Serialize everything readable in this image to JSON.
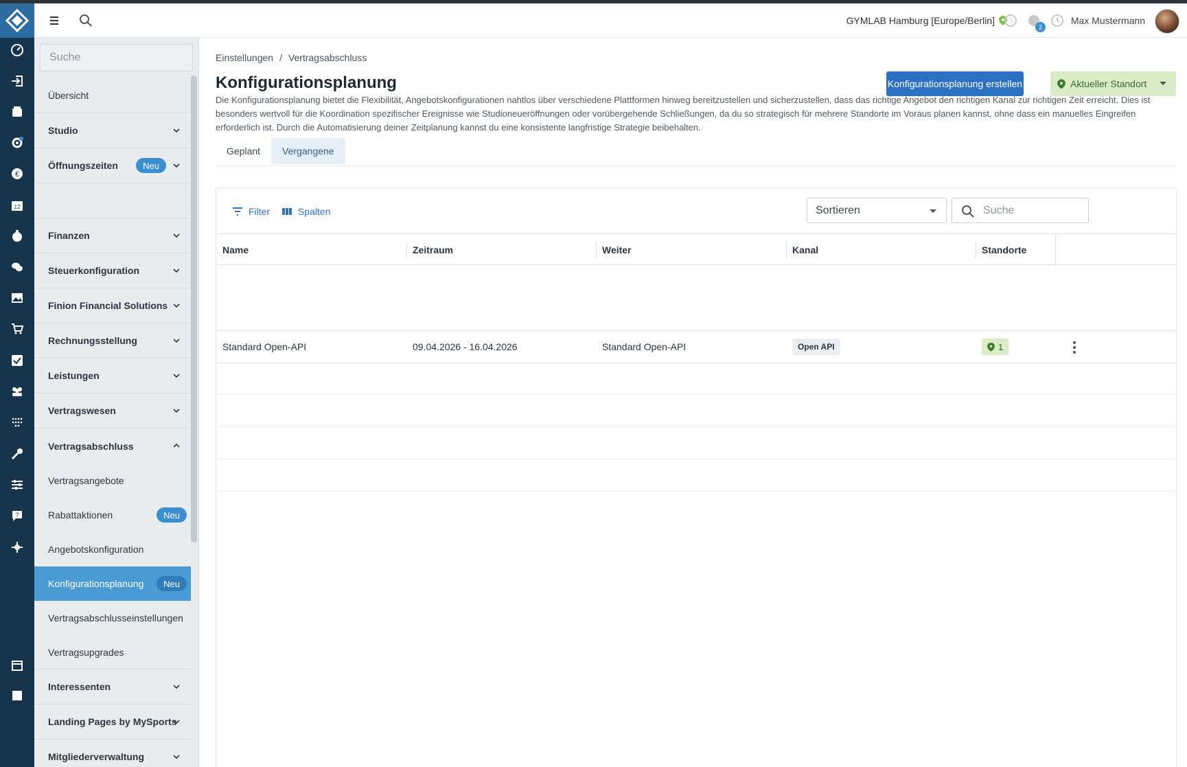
{
  "topbar": {
    "location": "GYMLAB Hamburg [Europe/Berlin]",
    "notification_count": "2",
    "user_name": "Max Mustermann"
  },
  "sidebar": {
    "search_placeholder": "Suche",
    "items": [
      {
        "label": "Übersicht"
      },
      {
        "label": "Studio"
      },
      {
        "label": "Öffnungszeiten",
        "badge": "Neu"
      },
      {
        "label": ""
      },
      {
        "label": "Finanzen"
      },
      {
        "label": "Steuerkonfiguration"
      },
      {
        "label": "Finion Financial Solutions"
      },
      {
        "label": "Rechnungsstellung"
      },
      {
        "label": "Leistungen"
      },
      {
        "label": "Vertragswesen"
      },
      {
        "label": "Vertragsabschluss"
      }
    ],
    "subitems": [
      {
        "label": "Vertragsangebote"
      },
      {
        "label": "Rabattaktionen",
        "badge": "Neu"
      },
      {
        "label": "Angebotskonfiguration"
      },
      {
        "label": "Konfigurationsplanung",
        "badge": "Neu"
      },
      {
        "label": "Vertragsabschlusseinstellungen"
      },
      {
        "label": "Vertragsupgrades"
      }
    ],
    "items_after": [
      {
        "label": "Interessenten"
      },
      {
        "label": "Landing Pages by MySports"
      },
      {
        "label": "Mitgliederverwaltung"
      }
    ]
  },
  "main": {
    "breadcrumb": [
      "Einstellungen",
      "Vertragsabschluss"
    ],
    "breadcrumb_sep": "/",
    "title": "Konfigurationsplanung",
    "create_button": "Konfigurationsplanung erstellen",
    "location_button": "Aktueller Standort",
    "description": "Die Konfigurationsplanung bietet die Flexibilität, Angebotskonfigurationen nahtlos über verschiedene Plattformen hinweg bereitzustellen und sicherzustellen, dass das richtige Angebot den richtigen Kanal zur richtigen Zeit erreicht. Dies ist besonders wertvoll für die Koordination spezifischer Ereignisse wie Studioneueröffnungen oder vorübergehende Schließungen, da du so strategisch für mehrere Standorte im Voraus planen kannst, ohne dass ein manuelles Eingreifen erforderlich ist. Durch die Automatisierung deiner Zeitplanung kannst du eine konsistente langfristige Strategie beibehalten.",
    "tabs": [
      {
        "label": "Geplant"
      },
      {
        "label": "Vergangene"
      }
    ],
    "toolbar": {
      "filter_label": "Filter",
      "columns_label": "Spalten",
      "sort_label": "Sortieren",
      "search_placeholder": "Suche"
    },
    "table": {
      "columns": [
        "Name",
        "Zeitraum",
        "Weiter",
        "Kanal",
        "Standorte"
      ],
      "rows": [
        {
          "name": "Standard Open-API",
          "period": "09.04.2026 - 16.04.2026",
          "next": "Standard Open-API",
          "channel": "Open API",
          "locations": "1"
        }
      ]
    }
  },
  "colors": {
    "accent": "#2d72c2",
    "rail": "#16354c",
    "active_item": "#4a9ad4",
    "location_chip": "#d9ecc6"
  }
}
